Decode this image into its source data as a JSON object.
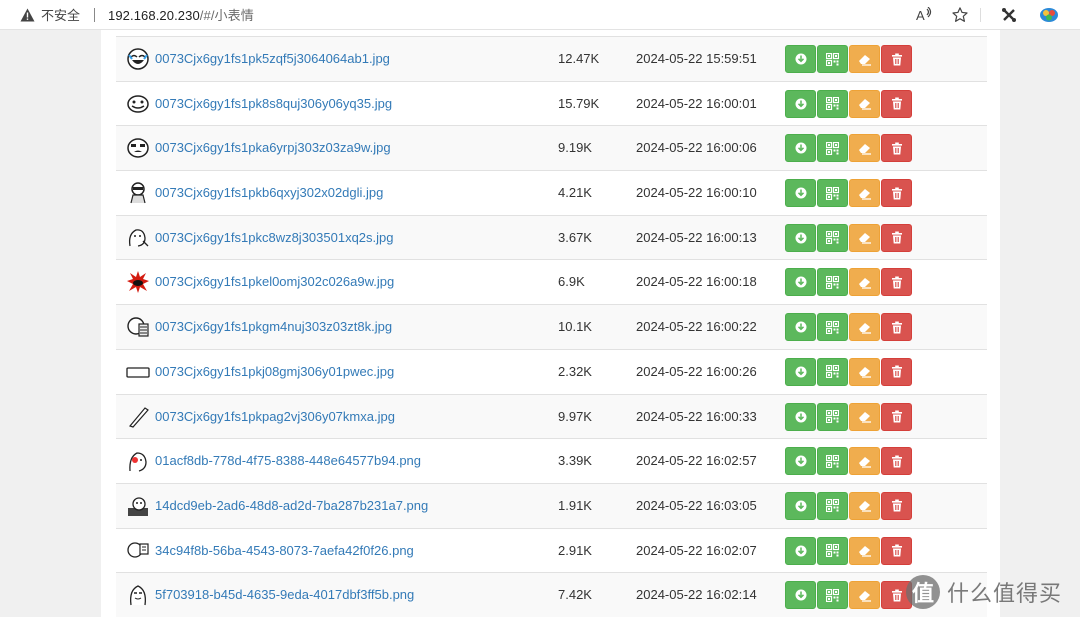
{
  "browser": {
    "security_label": "不安全",
    "url_host": "192.168.20.230",
    "url_path": "/#/小表情"
  },
  "files": [
    {
      "name": "0073Cjx6gy1fs1pk5zqf5j3064064ab1.jpg",
      "size": "12.47K",
      "date": "2024-05-22 15:59:51"
    },
    {
      "name": "0073Cjx6gy1fs1pk8s8quj306y06yq35.jpg",
      "size": "15.79K",
      "date": "2024-05-22 16:00:01"
    },
    {
      "name": "0073Cjx6gy1fs1pka6yrpj303z03za9w.jpg",
      "size": "9.19K",
      "date": "2024-05-22 16:00:06"
    },
    {
      "name": "0073Cjx6gy1fs1pkb6qxyj302x02dgli.jpg",
      "size": "4.21K",
      "date": "2024-05-22 16:00:10"
    },
    {
      "name": "0073Cjx6gy1fs1pkc8wz8j303501xq2s.jpg",
      "size": "3.67K",
      "date": "2024-05-22 16:00:13"
    },
    {
      "name": "0073Cjx6gy1fs1pkel0omj302c026a9w.jpg",
      "size": "6.9K",
      "date": "2024-05-22 16:00:18"
    },
    {
      "name": "0073Cjx6gy1fs1pkgm4nuj303z03zt8k.jpg",
      "size": "10.1K",
      "date": "2024-05-22 16:00:22"
    },
    {
      "name": "0073Cjx6gy1fs1pkj08gmj306y01pwec.jpg",
      "size": "2.32K",
      "date": "2024-05-22 16:00:26"
    },
    {
      "name": "0073Cjx6gy1fs1pkpag2vj306y07kmxa.jpg",
      "size": "9.97K",
      "date": "2024-05-22 16:00:33"
    },
    {
      "name": "01acf8db-778d-4f75-8388-448e64577b94.png",
      "size": "3.39K",
      "date": "2024-05-22 16:02:57"
    },
    {
      "name": "14dcd9eb-2ad6-48d8-ad2d-7ba287b231a7.png",
      "size": "1.91K",
      "date": "2024-05-22 16:03:05"
    },
    {
      "name": "34c94f8b-56ba-4543-8073-7aefa42f0f26.png",
      "size": "2.91K",
      "date": "2024-05-22 16:02:07"
    },
    {
      "name": "5f703918-b45d-4635-9eda-4017dbf3ff5b.png",
      "size": "7.42K",
      "date": "2024-05-22 16:02:14"
    }
  ],
  "thumb_icons": [
    "laughing-face-icon",
    "grinning-face-icon",
    "crying-face-icon",
    "masked-face-icon",
    "thinking-face-icon",
    "red-splash-icon",
    "reading-face-icon",
    "phone-icon",
    "pencil-icon",
    "nosebleed-face-icon",
    "ghost-icon",
    "card-holding-face-icon",
    "bearded-face-icon"
  ],
  "action_icons": [
    "download-icon",
    "qrcode-icon",
    "eraser-icon",
    "trash-icon"
  ],
  "colors": {
    "link": "#337ab7",
    "success": "#5cb85c",
    "warning": "#f0ad4e",
    "danger": "#d9534f"
  },
  "watermark": {
    "logo_char": "值",
    "text": "什么值得买"
  }
}
